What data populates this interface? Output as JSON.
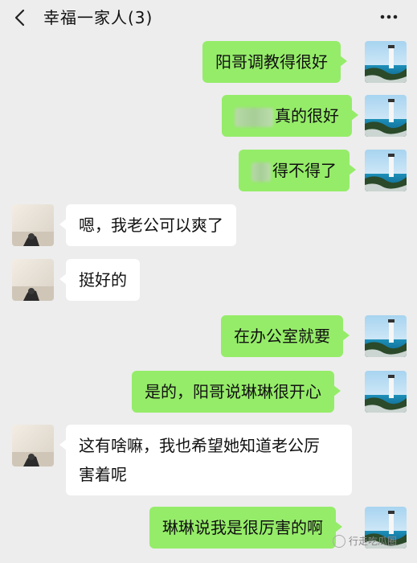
{
  "header": {
    "title": "幸福一家人(3)"
  },
  "messages": [
    {
      "side": "me",
      "text": "阳哥调教得很好"
    },
    {
      "side": "me",
      "text": "真的很好",
      "redacted": true
    },
    {
      "side": "me",
      "text": "得不得了",
      "redacted": true
    },
    {
      "side": "other",
      "text": "嗯，我老公可以爽了"
    },
    {
      "side": "other",
      "text": "挺好的"
    },
    {
      "side": "me",
      "text": "在办公室就要"
    },
    {
      "side": "me",
      "text": "是的，阳哥说琳琳很开心"
    },
    {
      "side": "other",
      "text_line1": "这有啥嘛，我也希望她知道老公厉",
      "text_line2": "害着呢"
    },
    {
      "side": "me",
      "text": "琳琳说我是很厉害的啊"
    }
  ],
  "watermark": {
    "text": "行走吃瓜圈"
  },
  "icons": {
    "back": "chevron-left-icon",
    "more": "more-dots-icon"
  },
  "colors": {
    "background": "#ededed",
    "my_bubble": "#95ec69",
    "other_bubble": "#ffffff"
  }
}
